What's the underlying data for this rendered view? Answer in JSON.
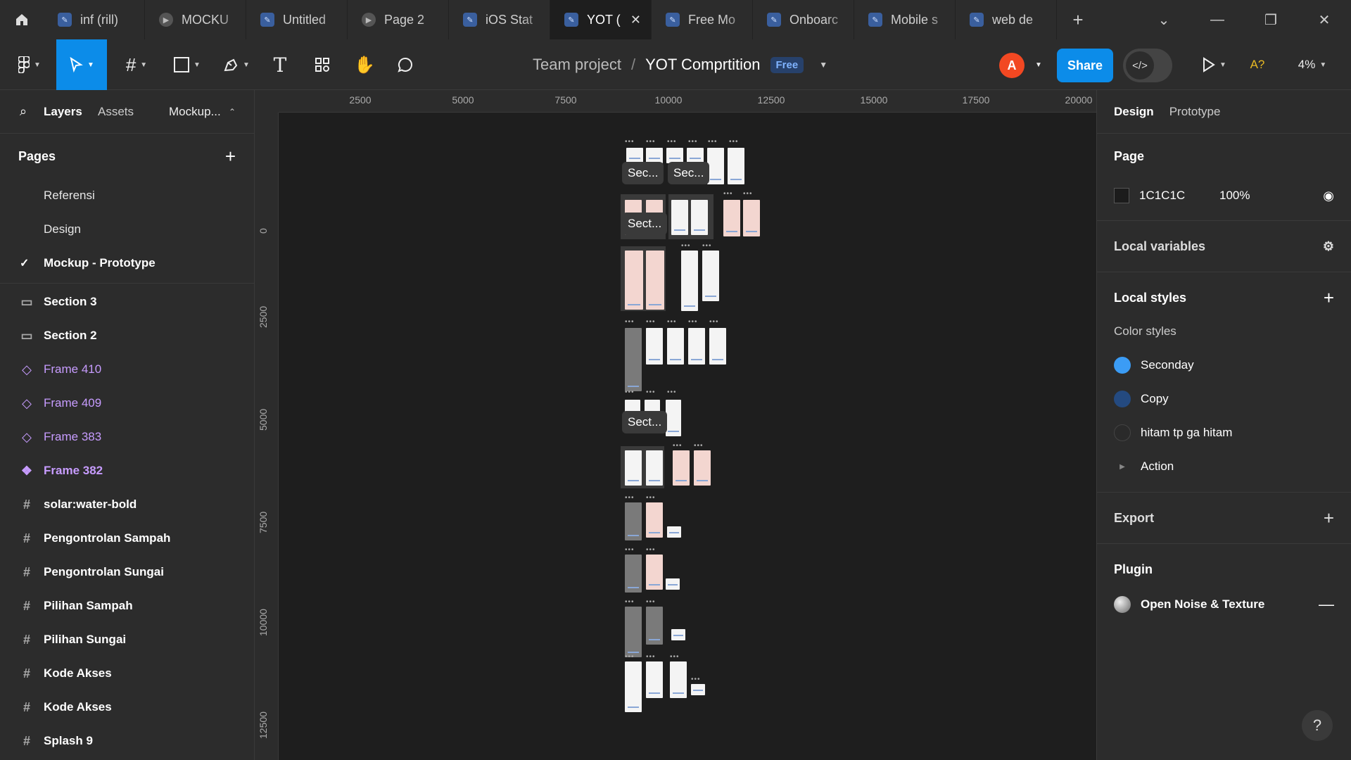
{
  "tabs": [
    {
      "label": "inf (rill)",
      "icon": "figma-file"
    },
    {
      "label": "MOCKU",
      "icon": "play"
    },
    {
      "label": "Untitled",
      "icon": "figma-file"
    },
    {
      "label": "Page 2",
      "icon": "play"
    },
    {
      "label": "iOS Stat",
      "icon": "figma-file"
    },
    {
      "label": "YOT (",
      "icon": "figma-file",
      "active": true
    },
    {
      "label": "Free Mo",
      "icon": "figma-file"
    },
    {
      "label": "Onboarc",
      "icon": "figma-file"
    },
    {
      "label": "Mobile s",
      "icon": "figma-file"
    },
    {
      "label": "web de",
      "icon": "figma-file"
    }
  ],
  "toolbar": {
    "project": "Team project",
    "separator": "/",
    "file_name": "YOT Comprtition",
    "plan_badge": "Free",
    "avatar_initial": "A",
    "share_label": "Share",
    "devmode_label": "</>",
    "font_warning": "A?",
    "zoom": "4%"
  },
  "left_panel": {
    "tab_layers": "Layers",
    "tab_assets": "Assets",
    "current_page_short": "Mockup...",
    "pages_heading": "Pages",
    "pages": [
      {
        "label": "Referensi"
      },
      {
        "label": "Design"
      },
      {
        "label": "Mockup - Prototype",
        "current": true
      }
    ],
    "layers": [
      {
        "label": "Section 3",
        "icon": "section"
      },
      {
        "label": "Section 2",
        "icon": "section"
      },
      {
        "label": "Frame 410",
        "icon": "component-instance"
      },
      {
        "label": "Frame 409",
        "icon": "component-instance"
      },
      {
        "label": "Frame 383",
        "icon": "component-instance"
      },
      {
        "label": "Frame 382",
        "icon": "component-main"
      },
      {
        "label": "solar:water-bold",
        "icon": "frame"
      },
      {
        "label": "Pengontrolan Sampah",
        "icon": "frame"
      },
      {
        "label": "Pengontrolan Sungai",
        "icon": "frame"
      },
      {
        "label": "Pilihan Sampah",
        "icon": "frame"
      },
      {
        "label": "Pilihan Sungai",
        "icon": "frame"
      },
      {
        "label": "Kode Akses",
        "icon": "frame"
      },
      {
        "label": "Kode Akses",
        "icon": "frame"
      },
      {
        "label": "Splash 9",
        "icon": "frame"
      }
    ]
  },
  "canvas": {
    "ruler_x": [
      "2500",
      "5000",
      "7500",
      "10000",
      "12500",
      "15000",
      "17500",
      "20000"
    ],
    "ruler_y": [
      "0",
      "2500",
      "5000",
      "7500",
      "10000",
      "12500"
    ],
    "section_labels": [
      "Sec...",
      "Sec...",
      "Sect...",
      "Sect..."
    ]
  },
  "right_panel": {
    "tab_design": "Design",
    "tab_prototype": "Prototype",
    "page_heading": "Page",
    "page_color": "1C1C1C",
    "page_opacity": "100%",
    "local_variables": "Local variables",
    "local_styles": "Local styles",
    "color_styles_heading": "Color styles",
    "color_styles": [
      {
        "label": "Seconday",
        "color": "#3b9cf5"
      },
      {
        "label": "Copy",
        "color": "#244a80"
      },
      {
        "label": "hitam tp ga hitam",
        "color": "#2a2a2a"
      }
    ],
    "action_group": "Action",
    "export_heading": "Export",
    "plugin_heading": "Plugin",
    "plugin_name": "Open Noise & Texture"
  },
  "help_label": "?"
}
